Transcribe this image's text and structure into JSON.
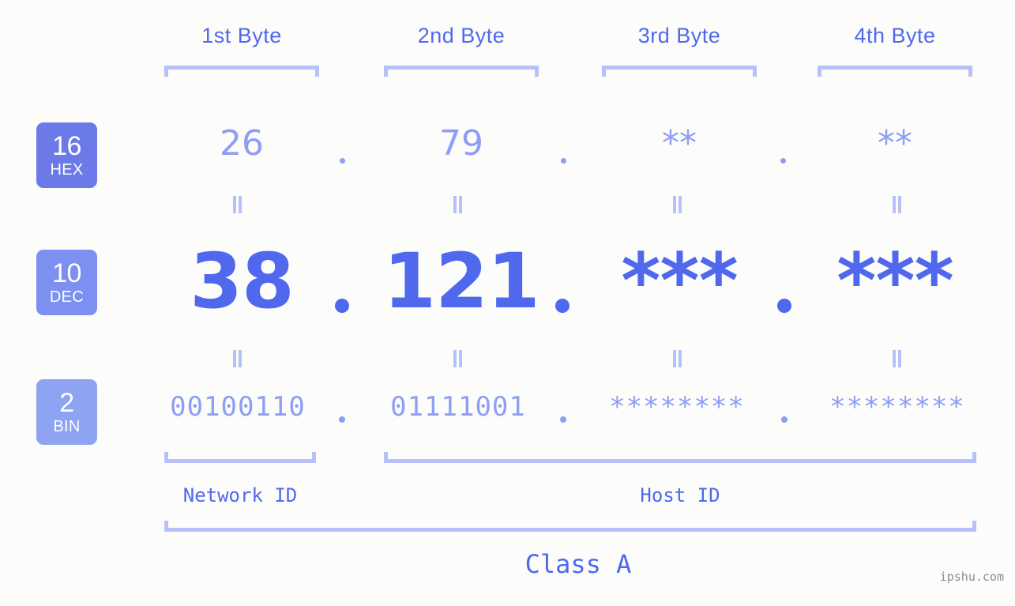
{
  "page": {
    "background_color": "#fcfdfa",
    "accent_strong": "#5068ee",
    "accent_mid": "#8e9df5",
    "accent_light": "#b6c0fb",
    "watermark": "ipshu.com"
  },
  "byte_headers": [
    {
      "label": "1st Byte"
    },
    {
      "label": "2nd Byte"
    },
    {
      "label": "3rd Byte"
    },
    {
      "label": "4th Byte"
    }
  ],
  "radix_badges": [
    {
      "number": "16",
      "name": "HEX",
      "color": "#6b7ae8"
    },
    {
      "number": "10",
      "name": "DEC",
      "color": "#7d8ff0"
    },
    {
      "number": "2",
      "name": "BIN",
      "color": "#8fa3f3"
    }
  ],
  "rows": {
    "hex": {
      "radix": "16",
      "radix_name": "HEX",
      "values": [
        "26",
        "79",
        "**",
        "**"
      ],
      "separator": "."
    },
    "dec": {
      "radix": "10",
      "radix_name": "DEC",
      "values": [
        "38",
        "121",
        "***",
        "***"
      ],
      "separator": "."
    },
    "bin": {
      "radix": "2",
      "radix_name": "BIN",
      "values": [
        "00100110",
        "01111001",
        "********",
        "********"
      ],
      "separator": "."
    }
  },
  "connector": {
    "symbol": "||",
    "meaning": "equals"
  },
  "regions": [
    {
      "label": "Network ID",
      "spans_bytes": "1"
    },
    {
      "label": "Host ID",
      "spans_bytes": "2-4"
    }
  ],
  "class": {
    "label": "Class A"
  }
}
